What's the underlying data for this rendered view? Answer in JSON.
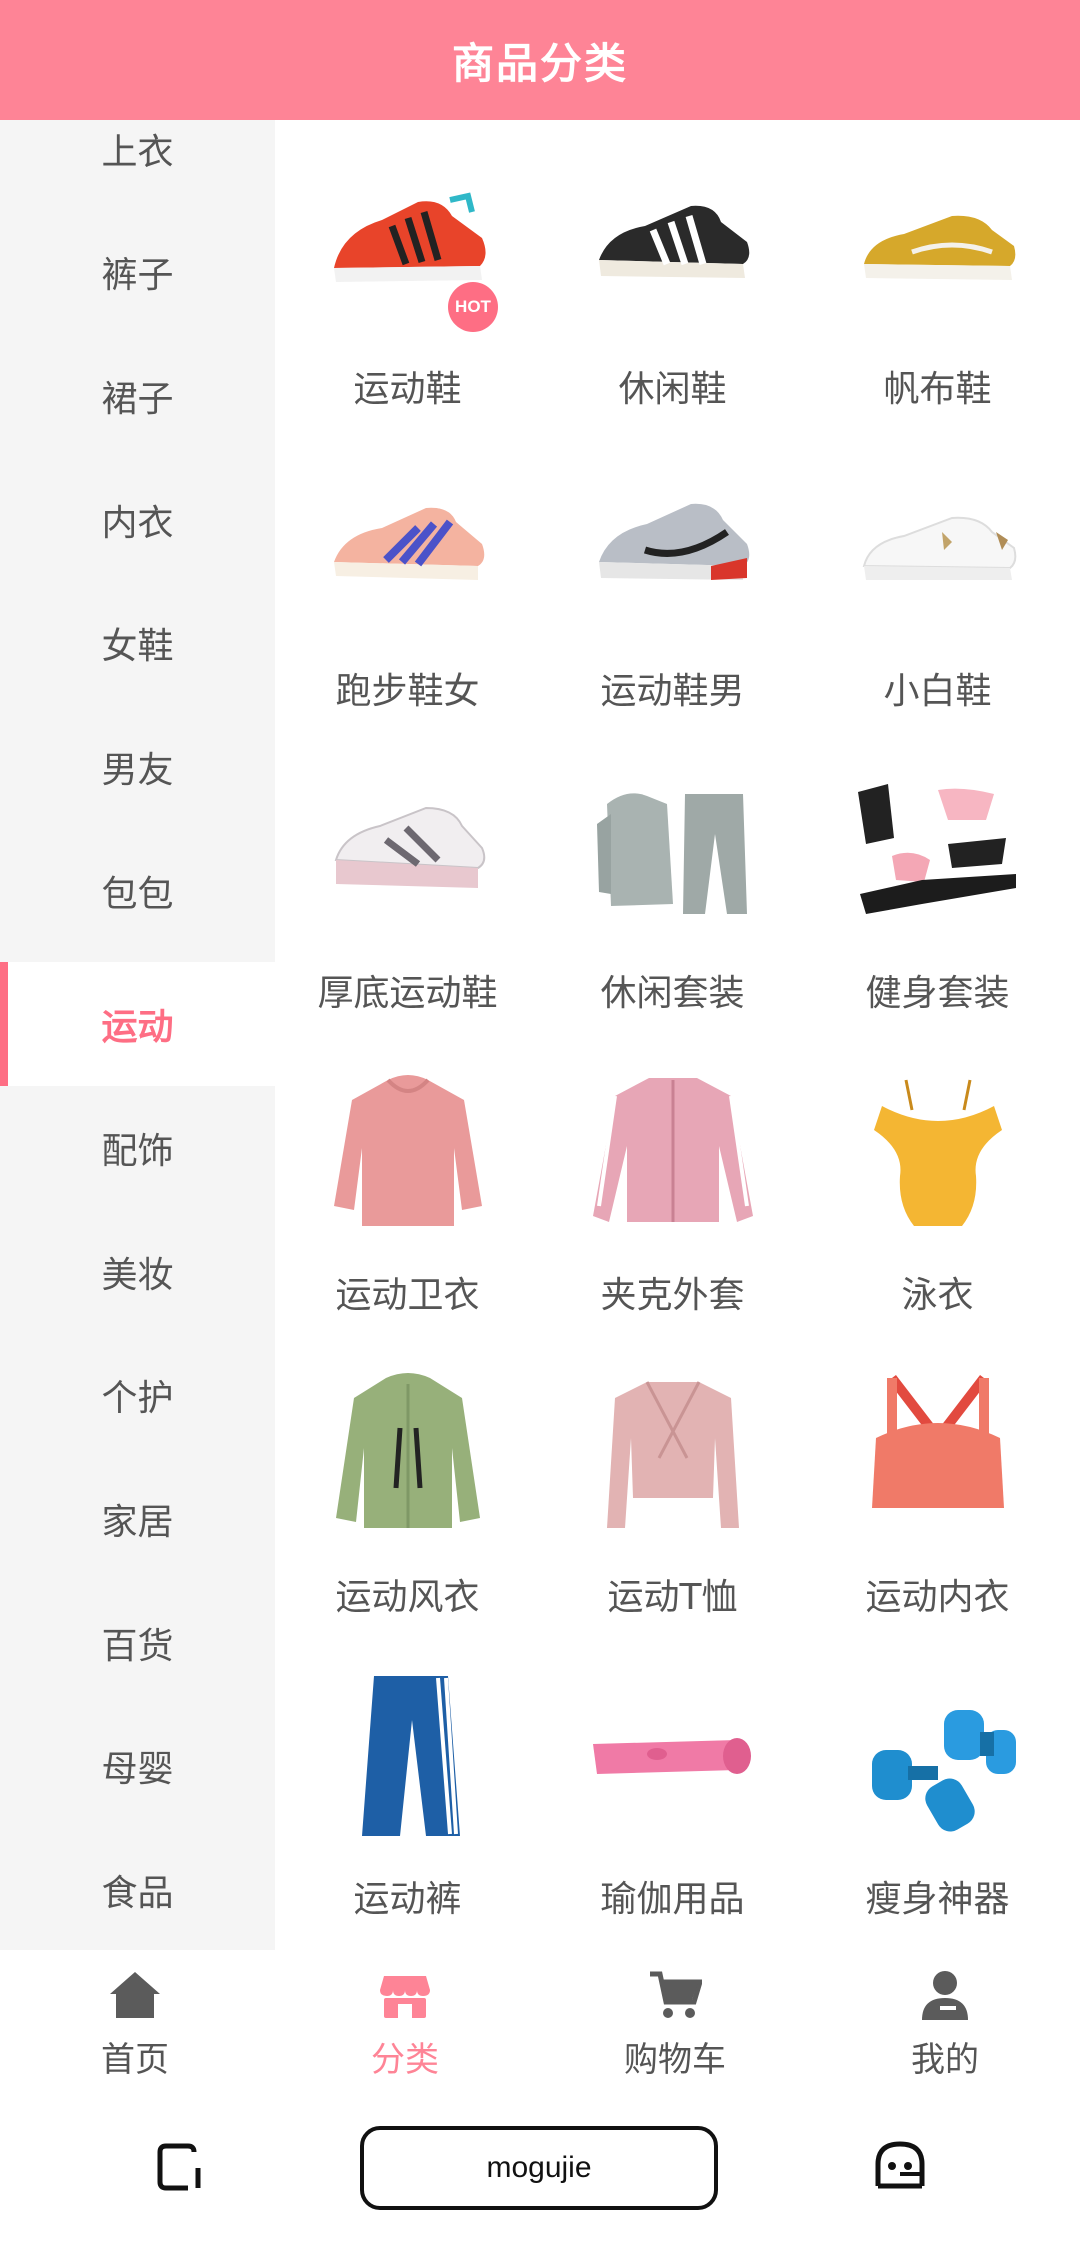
{
  "header": {
    "title": "商品分类"
  },
  "sidebar": {
    "items": [
      "上衣",
      "裤子",
      "裙子",
      "内衣",
      "女鞋",
      "男友",
      "包包",
      "运动",
      "配饰",
      "美妆",
      "个护",
      "家居",
      "百货",
      "母婴",
      "食品"
    ],
    "active": "运动"
  },
  "grid": {
    "items": [
      {
        "label": "运动鞋",
        "icon": "sneaker-red-icon",
        "badge": "HOT"
      },
      {
        "label": "休闲鞋",
        "icon": "sneaker-black-white-icon"
      },
      {
        "label": "帆布鞋",
        "icon": "canvas-shoe-yellow-icon"
      },
      {
        "label": "跑步鞋女",
        "icon": "running-shoe-pink-icon"
      },
      {
        "label": "运动鞋男",
        "icon": "sneaker-grey-icon"
      },
      {
        "label": "小白鞋",
        "icon": "white-sneaker-icon"
      },
      {
        "label": "厚底运动鞋",
        "icon": "chunky-sneaker-icon"
      },
      {
        "label": "休闲套装",
        "icon": "grey-tracksuit-icon"
      },
      {
        "label": "健身套装",
        "icon": "fitness-set-icon"
      },
      {
        "label": "运动卫衣",
        "icon": "pink-hoodie-icon"
      },
      {
        "label": "夹克外套",
        "icon": "pink-jacket-icon"
      },
      {
        "label": "泳衣",
        "icon": "yellow-swimsuit-icon"
      },
      {
        "label": "运动风衣",
        "icon": "green-windbreaker-icon"
      },
      {
        "label": "运动T恤",
        "icon": "pink-wrap-top-icon"
      },
      {
        "label": "运动内衣",
        "icon": "sports-bra-icon"
      },
      {
        "label": "运动裤",
        "icon": "blue-track-pants-icon"
      },
      {
        "label": "瑜伽用品",
        "icon": "yoga-mat-icon"
      },
      {
        "label": "瘦身神器",
        "icon": "dumbbell-icon"
      }
    ]
  },
  "tabbar": {
    "items": [
      {
        "label": "首页",
        "icon": "home-icon"
      },
      {
        "label": "分类",
        "icon": "store-icon",
        "active": true
      },
      {
        "label": "购物车",
        "icon": "cart-icon"
      },
      {
        "label": "我的",
        "icon": "user-icon"
      }
    ]
  },
  "system_nav": {
    "app_label": "mogujie"
  },
  "colors": {
    "accent": "#fe8496",
    "active_text": "#fe6e84",
    "sidebar_bg": "#f5f5f5",
    "text": "#555555"
  }
}
